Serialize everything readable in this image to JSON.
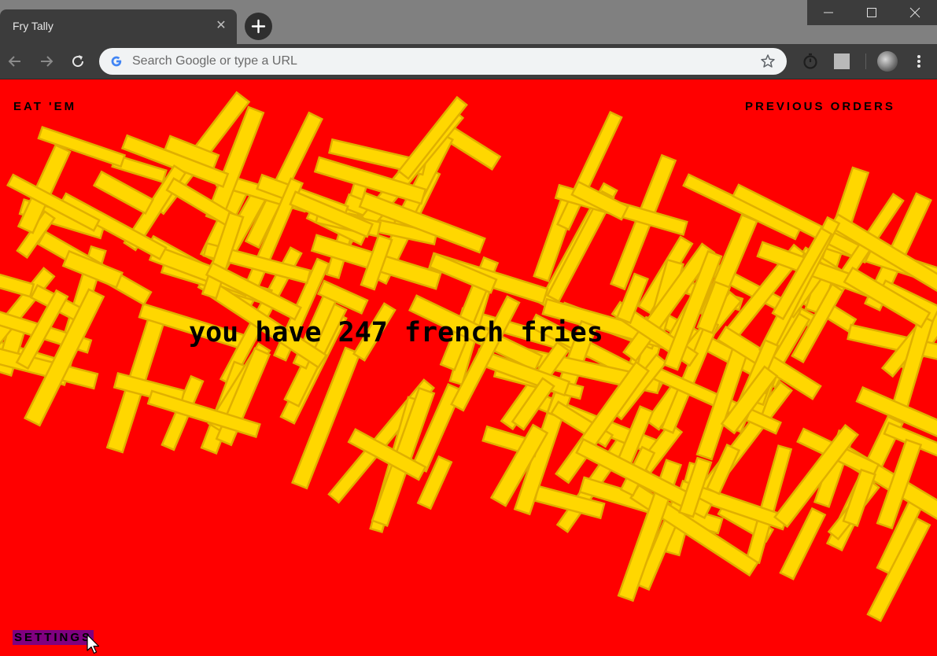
{
  "browser": {
    "tab_title": "Fry Tally",
    "tab_close_icon": "close-icon",
    "new_tab_icon": "plus-icon",
    "omnibox_placeholder": "Search Google or type a URL",
    "window_controls": [
      "minimize-icon",
      "maximize-icon",
      "close-icon"
    ],
    "toolbar_icons": [
      "back-icon",
      "forward-icon",
      "reload-icon",
      "star-icon",
      "timer-icon",
      "extension-icon",
      "avatar",
      "menu-icon"
    ]
  },
  "page": {
    "nav_left": "EAT 'EM",
    "nav_right": "PREVIOUS ORDERS",
    "counter_text": "you have 247 french fries",
    "settings_label": "SETTINGS",
    "colors": {
      "background": "#ff0000",
      "fry": "#ffd700",
      "fry_edge": "#e0b000",
      "settings_highlight": "#800080"
    }
  }
}
